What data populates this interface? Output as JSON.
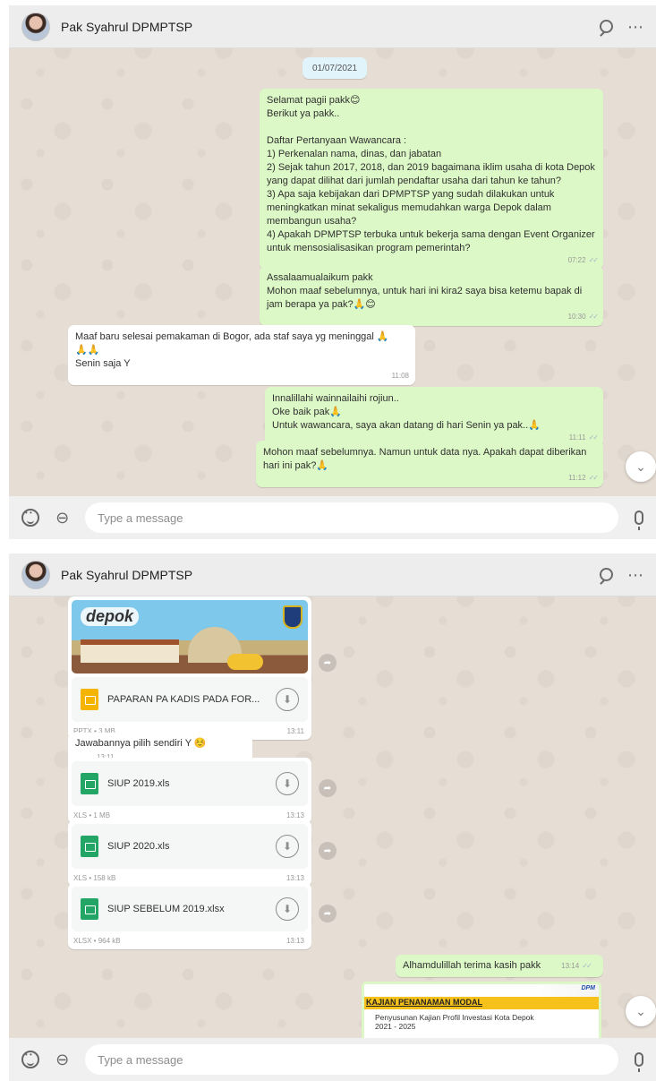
{
  "contact": {
    "name": "Pak Syahrul DPMPTSP"
  },
  "composer": {
    "placeholder": "Type a message"
  },
  "top": {
    "date_chip": "01/07/2021",
    "messages": [
      {
        "dir": "out",
        "text": "Selamat pagii pakk😊\nBerikut ya pakk..\n\nDaftar Pertanyaan Wawancara :\n1) Perkenalan nama, dinas, dan jabatan\n2) Sejak tahun 2017, 2018, dan 2019 bagaimana iklim usaha di kota Depok yang dapat dilihat dari jumlah pendaftar usaha dari tahun ke tahun?\n3) Apa saja kebijakan dari DPMPTSP yang sudah dilakukan untuk meningkatkan minat sekaligus memudahkan warga Depok dalam membangun usaha?\n4) Apakah DPMPTSP terbuka untuk bekerja sama dengan Event Organizer untuk mensosialisasikan program pemerintah?",
        "time": "07:22"
      },
      {
        "dir": "out",
        "text": "Assalaamualaikum pakk\nMohon maaf sebelumnya, untuk hari ini kira2 saya bisa ketemu bapak di jam berapa ya pak?🙏😊",
        "time": "10:30"
      },
      {
        "dir": "in",
        "text": "Maaf baru selesai pemakaman di Bogor, ada staf saya yg meninggal 🙏\n🙏🙏\nSenin saja Y",
        "time": "11:08"
      },
      {
        "dir": "out",
        "text": "Innalillahi wainnailaihi rojiun..\nOke baik pak🙏\nUntuk wawancara, saya akan datang di hari Senin ya pak..🙏",
        "time": "11:11"
      },
      {
        "dir": "out",
        "text": "Mohon maaf sebelumnya. Namun untuk data nya. Apakah dapat diberikan hari ini pak?🙏",
        "time": "11:12"
      }
    ]
  },
  "bottom": {
    "pptx": {
      "logo": "depok",
      "name": "PAPARAN PA KADIS PADA FOR...",
      "meta": "PPTX • 3 MB",
      "time": "13:11"
    },
    "reply": {
      "text": "Jawabannya pilih sendiri Y ☺️",
      "time": "13:11"
    },
    "files": [
      {
        "name": "SIUP 2019.xls",
        "meta": "XLS • 1 MB",
        "time": "13:13"
      },
      {
        "name": "SIUP 2020.xls",
        "meta": "XLS • 158 kB",
        "time": "13:13"
      },
      {
        "name": "SIUP SEBELUM 2019.xlsx",
        "meta": "XLSX • 964 kB",
        "time": "13:13"
      }
    ],
    "thanks": {
      "text": "Alhamdulillah terima kasih pakk",
      "time": "13:14"
    },
    "kajian": {
      "logo": "DPM",
      "title": "KAJIAN PENANAMAN MODAL",
      "subtitle_1": "Penyusunan Kajian Profil Investasi Kota Depok",
      "subtitle_2": "2021 - 2025"
    }
  },
  "icons": {
    "search": "search-icon",
    "menu": "more-vertical-icon",
    "emoji": "emoji-icon",
    "attach": "paperclip-icon",
    "mic": "microphone-icon",
    "download": "download-icon",
    "forward": "forward-icon",
    "scroll": "chevron-down-icon"
  },
  "colors": {
    "outgoing": "#dcf8c6",
    "incoming": "#ffffff",
    "header": "#ededed",
    "chat_bg": "#e5ddd5",
    "ticks": "#9fb6c9"
  }
}
